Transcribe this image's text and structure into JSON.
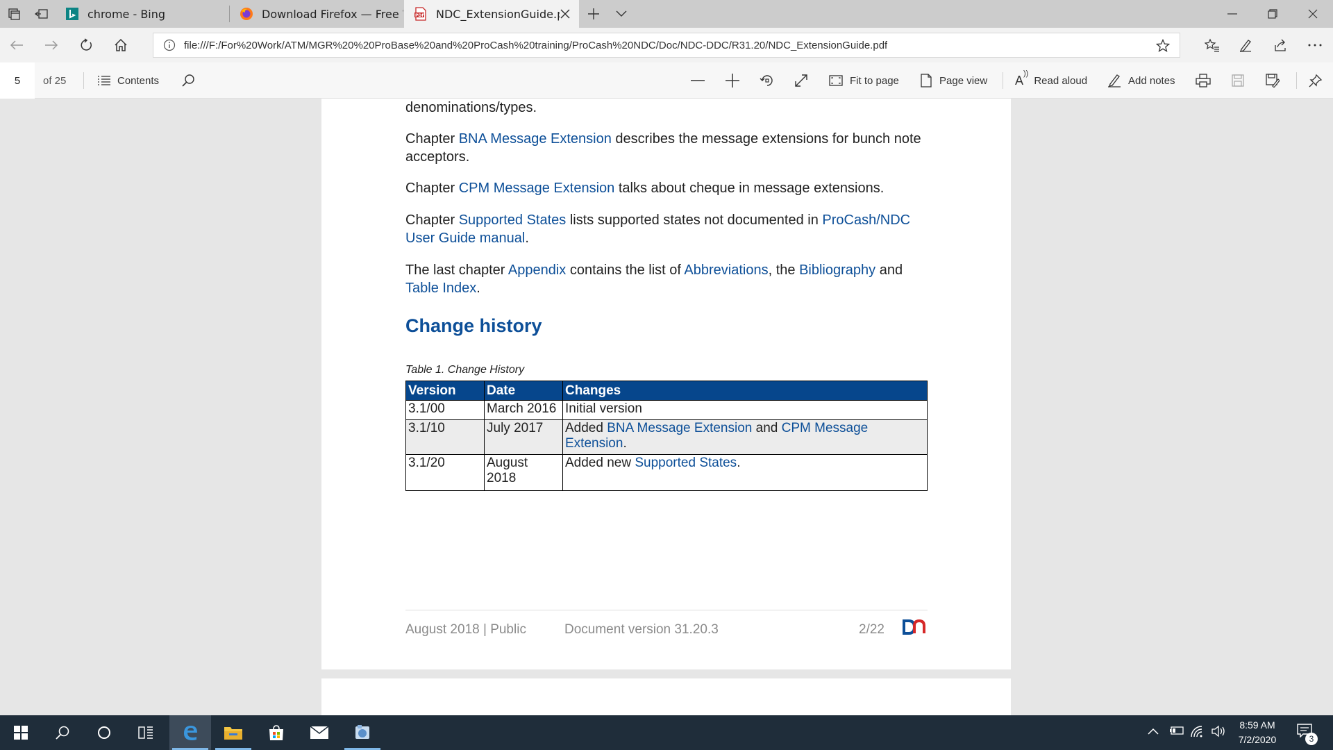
{
  "tabs": [
    {
      "label": "chrome - Bing",
      "icon": "bing-icon"
    },
    {
      "label": "Download Firefox — Free W",
      "icon": "firefox-icon"
    },
    {
      "label": "NDC_ExtensionGuide.pc",
      "icon": "pdf-icon",
      "active": true
    }
  ],
  "address": {
    "url": "file:///F:/For%20Work/ATM/MGR%20%20ProBase%20and%20ProCash%20training/ProCash%20NDC/Doc/NDC-DDC/R31.20/NDC_ExtensionGuide.pdf"
  },
  "pdf_toolbar": {
    "page_number": "5",
    "page_total": "of 25",
    "contents_label": "Contents",
    "fit_to_page_label": "Fit to page",
    "page_view_label": "Page view",
    "read_aloud_label": "Read aloud",
    "add_notes_label": "Add notes"
  },
  "document": {
    "p0": "denominations/types.",
    "p1": {
      "a": "Chapter ",
      "link": "BNA Message Extension",
      "b": " describes the message extensions for bunch note acceptors."
    },
    "p2": {
      "a": "Chapter ",
      "link": "CPM Message Extension",
      "b": " talks about cheque in message extensions."
    },
    "p3": {
      "a": "Chapter ",
      "link1": "Supported States",
      "b": " lists supported states not documented in ",
      "link2": "ProCash/NDC User Guide manual",
      "c": "."
    },
    "p4": {
      "a": "The last chapter ",
      "link1": "Appendix",
      "b": " contains the list of ",
      "link2": "Abbreviations",
      "c": ", the ",
      "link3": "Bibliography",
      "d": " and ",
      "link4": "Table Index",
      "e": "."
    },
    "heading": "Change history",
    "caption": "Table 1. Change History",
    "table": {
      "headers": [
        "Version",
        "Date",
        "Changes"
      ],
      "rows": [
        {
          "version": "3.1/00",
          "date": "March 2016",
          "changes": "Initial version"
        },
        {
          "version": "3.1/10",
          "date": "July 2017",
          "changes_a": "Added ",
          "changes_link1": "BNA Message Extension",
          "changes_b": " and ",
          "changes_link2": "CPM Message Extension",
          "changes_c": "."
        },
        {
          "version": "3.1/20",
          "date": "August 2018",
          "changes_a": "Added new ",
          "changes_link1": "Supported States",
          "changes_c": "."
        }
      ]
    },
    "footer": {
      "left": "August 2018 | Public",
      "middle": "Document version 31.20.3",
      "page": "2/22"
    }
  },
  "taskbar": {
    "time": "8:59 AM",
    "date": "7/2/2020",
    "notification_count": "3"
  },
  "colors": {
    "link": "#0d4f98",
    "table_header": "#06468c",
    "taskbar": "#1f2d3a"
  }
}
